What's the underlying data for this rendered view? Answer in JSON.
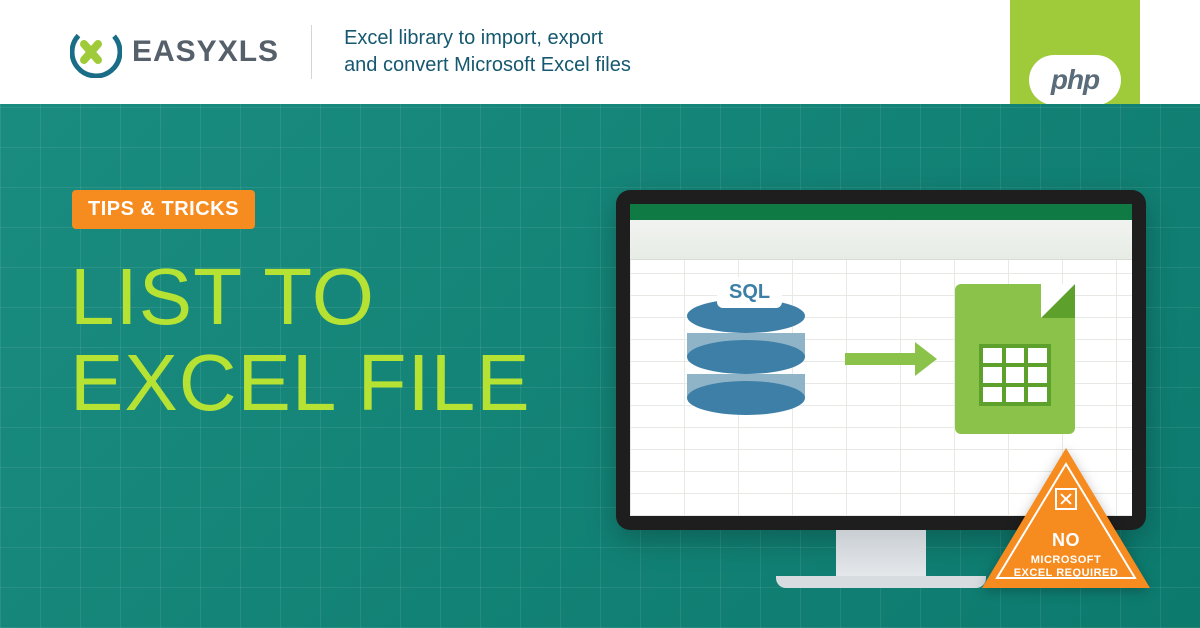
{
  "header": {
    "brand_prefix": "EASY",
    "brand_suffix": "XLS",
    "tagline_line1": "Excel library to import, export",
    "tagline_line2": "and convert Microsoft Excel files"
  },
  "ribbon": {
    "label": "php"
  },
  "content": {
    "tips_badge": "TIPS & TRICKS",
    "title_line1": "LIST TO",
    "title_line2": "EXCEL FILE",
    "sql_label": "SQL"
  },
  "warning": {
    "no": "NO",
    "line1": "MICROSOFT",
    "line2": "EXCEL REQUIRED"
  }
}
